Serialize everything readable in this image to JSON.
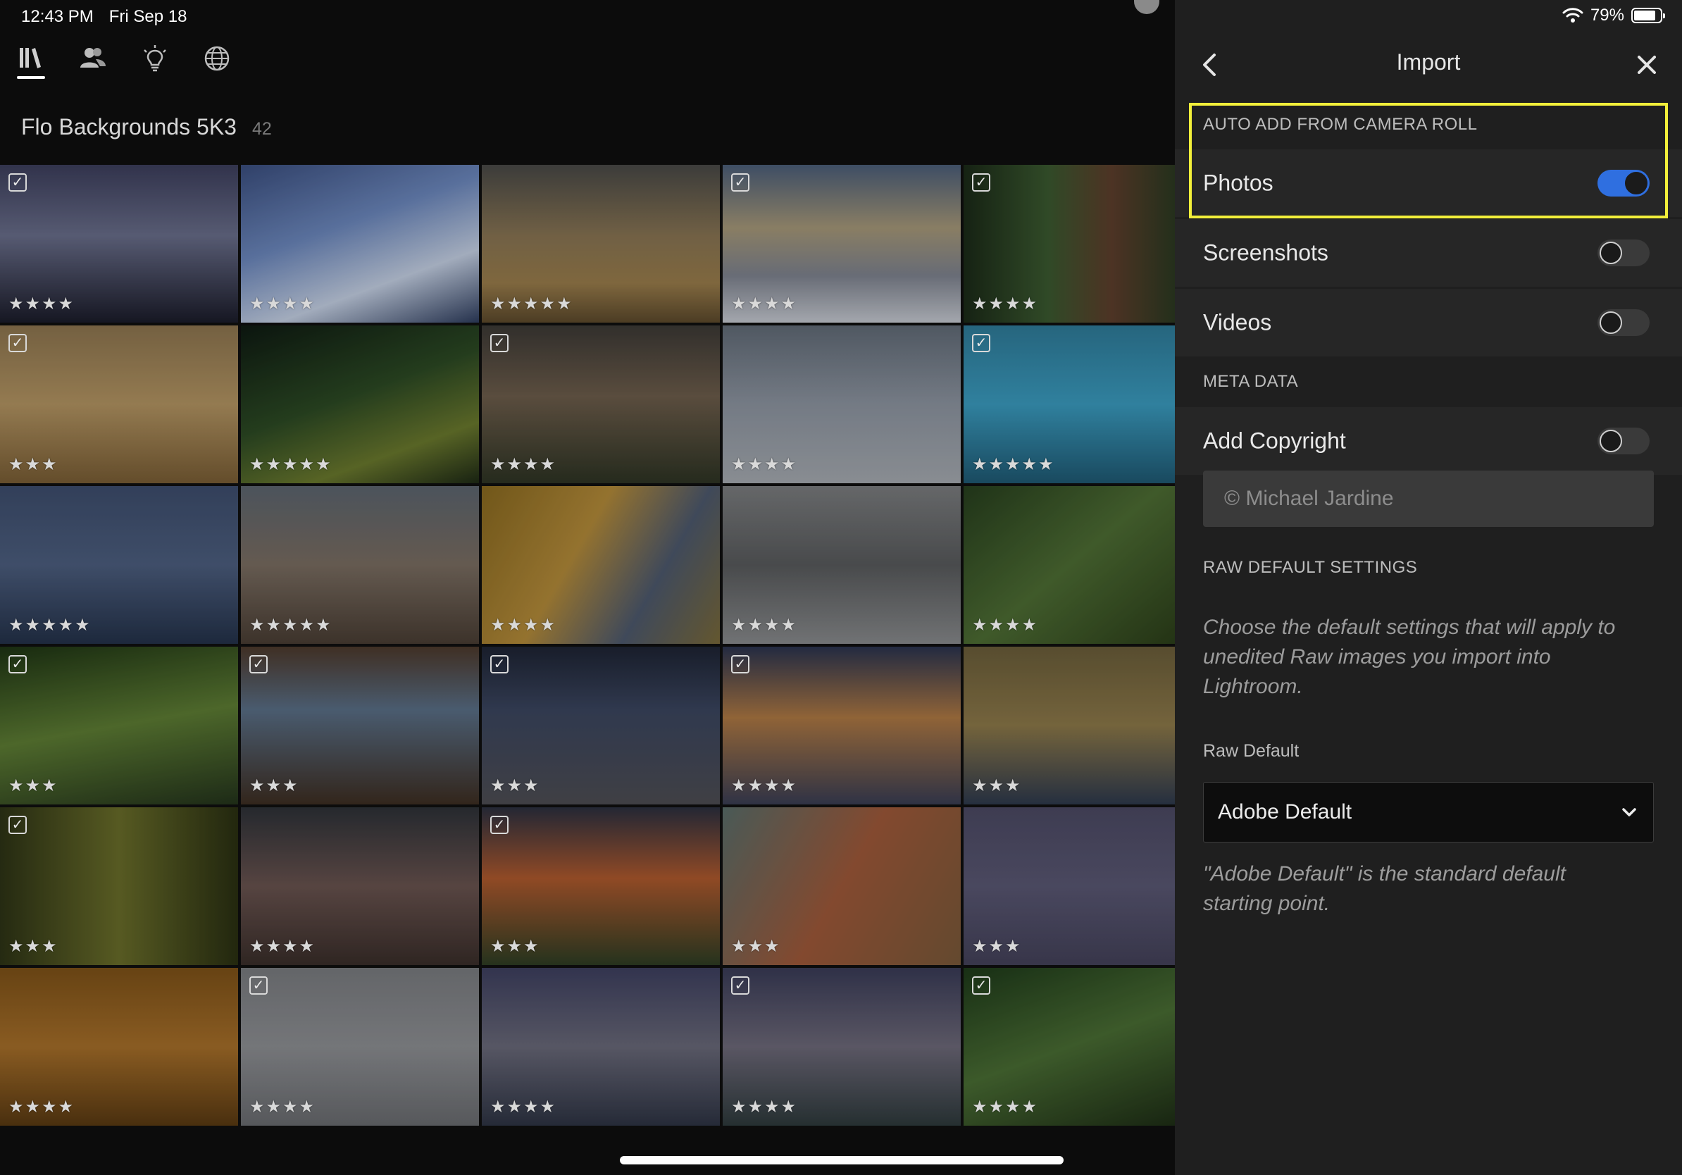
{
  "status_bar": {
    "time": "12:43 PM",
    "date": "Fri Sep 18",
    "battery": "79%"
  },
  "nav": {
    "items": [
      {
        "name": "library",
        "icon": "library-icon",
        "active": true
      },
      {
        "name": "people",
        "icon": "people-icon",
        "active": false
      },
      {
        "name": "learn",
        "icon": "lightbulb-icon",
        "active": false
      },
      {
        "name": "discover",
        "icon": "globe-icon",
        "active": false
      }
    ]
  },
  "album": {
    "title": "Flo Backgrounds 5K3",
    "count": "42"
  },
  "grid": {
    "rows": [
      [
        {
          "checked": true,
          "stars": 4
        },
        {
          "checked": false,
          "stars": 4
        },
        {
          "checked": false,
          "stars": 5
        },
        {
          "checked": true,
          "stars": 4
        },
        {
          "checked": true,
          "stars": 4
        }
      ],
      [
        {
          "checked": true,
          "stars": 3
        },
        {
          "checked": false,
          "stars": 5
        },
        {
          "checked": true,
          "stars": 4
        },
        {
          "checked": false,
          "stars": 4
        },
        {
          "checked": true,
          "stars": 5
        }
      ],
      [
        {
          "checked": false,
          "stars": 5
        },
        {
          "checked": false,
          "stars": 5
        },
        {
          "checked": false,
          "stars": 4
        },
        {
          "checked": false,
          "stars": 4
        },
        {
          "checked": false,
          "stars": 4
        }
      ],
      [
        {
          "checked": true,
          "stars": 3
        },
        {
          "checked": true,
          "stars": 3
        },
        {
          "checked": true,
          "stars": 3
        },
        {
          "checked": true,
          "stars": 4
        },
        {
          "checked": false,
          "stars": 3
        }
      ],
      [
        {
          "checked": true,
          "stars": 3
        },
        {
          "checked": false,
          "stars": 4
        },
        {
          "checked": true,
          "stars": 3
        },
        {
          "checked": false,
          "stars": 3
        },
        {
          "checked": false,
          "stars": 3
        }
      ],
      [
        {
          "checked": false,
          "stars": 4
        },
        {
          "checked": true,
          "stars": 4
        },
        {
          "checked": false,
          "stars": 4
        },
        {
          "checked": true,
          "stars": 4
        },
        {
          "checked": true,
          "stars": 4
        }
      ]
    ]
  },
  "panel": {
    "title": "Import",
    "auto_add_section": "AUTO ADD FROM CAMERA ROLL",
    "toggles": [
      {
        "label": "Photos",
        "on": true
      },
      {
        "label": "Screenshots",
        "on": false
      },
      {
        "label": "Videos",
        "on": false
      }
    ],
    "meta_section": "META DATA",
    "copyright_label": "Add Copyright",
    "copyright_on": false,
    "copyright_placeholder": "© Michael Jardine",
    "raw_section": "RAW DEFAULT SETTINGS",
    "raw_description": "Choose the default settings that will apply to unedited Raw images you import into Lightroom.",
    "raw_default_label": "Raw Default",
    "raw_default_value": "Adobe Default",
    "raw_default_note": "\"Adobe Default\" is the standard default starting point."
  },
  "colors": {
    "accent": "#2f6fe0",
    "highlight": "#f2ef3a",
    "panel_bg": "#1f1f1f"
  }
}
